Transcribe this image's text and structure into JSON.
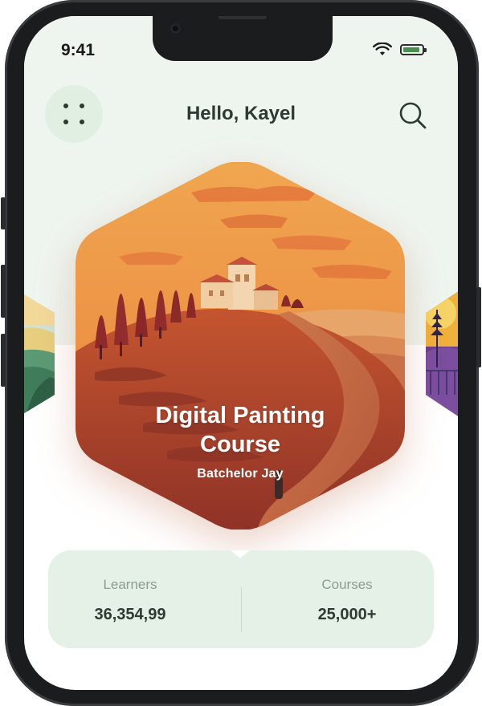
{
  "status_bar": {
    "time": "9:41"
  },
  "header": {
    "greeting": "Hello, Kayel"
  },
  "featured_course": {
    "title_line1": "Digital Painting",
    "title_line2": "Course",
    "author": "Batchelor Jay"
  },
  "stats": {
    "learners": {
      "label": "Learners",
      "value": "36,354,99"
    },
    "courses": {
      "label": "Courses",
      "value": "25,000+"
    }
  },
  "colors": {
    "background": "#eef5ef",
    "accent_green": "#e1efe3",
    "text_dark": "#2e3b33",
    "card_orange": "#e9843f",
    "card_red": "#a23a2d"
  },
  "icons": [
    "menu-dots-icon",
    "search-icon",
    "wifi-icon",
    "battery-icon"
  ]
}
